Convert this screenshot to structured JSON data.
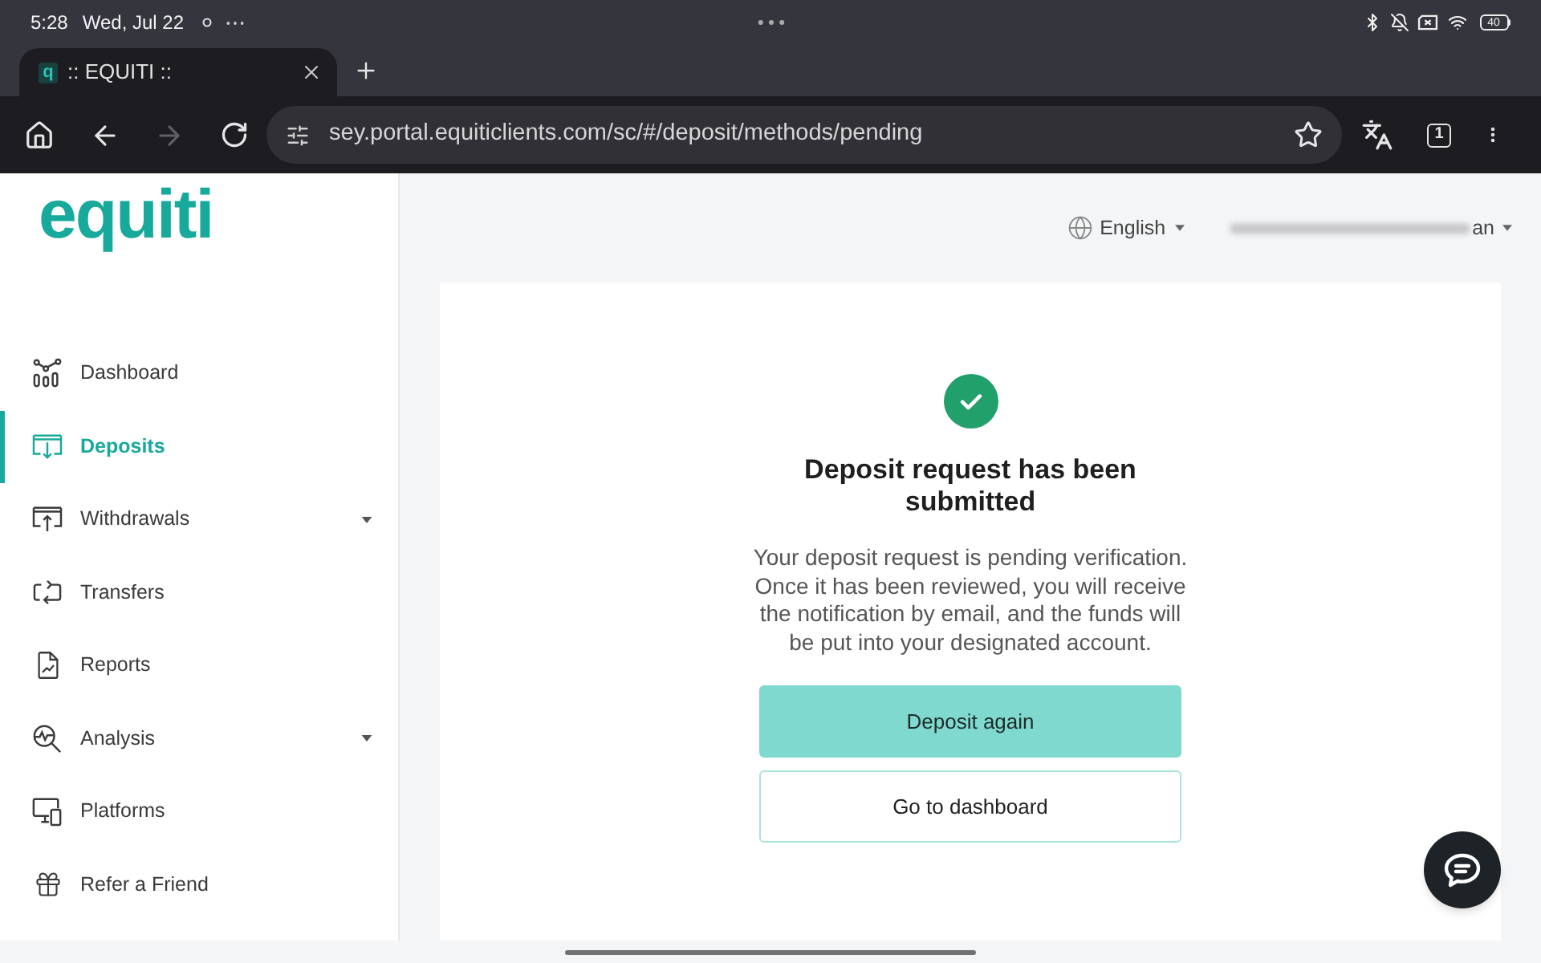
{
  "status_bar": {
    "time": "5:28",
    "date": "Wed, Jul 22",
    "battery": "40"
  },
  "browser": {
    "tabs": [
      {
        "favicon": "q",
        "title": ":: EQUITI ::",
        "selected": true
      }
    ],
    "forward_disabled": true,
    "url": "sey.portal.equiticlients.com/sc/#/deposit/methods/pending",
    "tab_count": "1"
  },
  "sidebar": {
    "logo": "equiti",
    "items": [
      {
        "label": "Dashboard",
        "selected": false,
        "has_submenu": false
      },
      {
        "label": "Deposits",
        "selected": true,
        "has_submenu": false
      },
      {
        "label": "Withdrawals",
        "selected": false,
        "has_submenu": true
      },
      {
        "label": "Transfers",
        "selected": false,
        "has_submenu": false
      },
      {
        "label": "Reports",
        "selected": false,
        "has_submenu": false
      },
      {
        "label": "Analysis",
        "selected": false,
        "has_submenu": true
      },
      {
        "label": "Platforms",
        "selected": false,
        "has_submenu": false
      },
      {
        "label": "Refer a Friend",
        "selected": false,
        "has_submenu": false
      }
    ]
  },
  "header": {
    "language": "English",
    "user_name_visible": "an"
  },
  "confirmation": {
    "title": "Deposit request has been submitted",
    "message": "Your deposit request is pending verification. Once it has been reviewed, you will receive the notification by email, and the funds will be put into your designated account.",
    "buttons": [
      {
        "label": "Deposit again",
        "kind": "primary"
      },
      {
        "label": "Go to dashboard",
        "kind": "outline"
      }
    ]
  }
}
